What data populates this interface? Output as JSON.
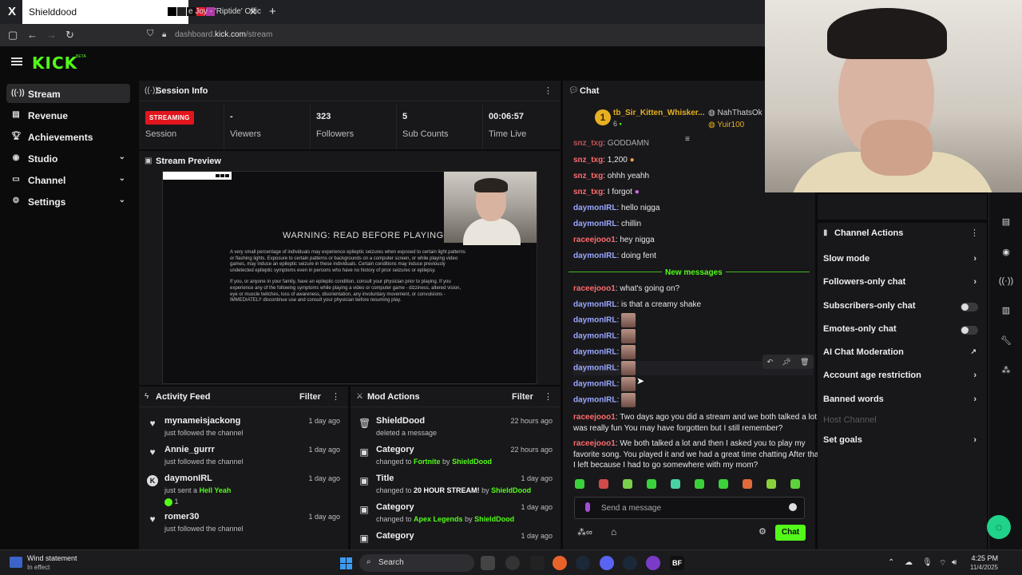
{
  "browser": {
    "active_tab_title": "Shielddood",
    "inactive_tab_title": "e Joy - 'Riptide' Offic",
    "url_prefix": "dashboard.",
    "url_host": "kick.com",
    "url_path": "/stream"
  },
  "header": {
    "logo_text": "KICK",
    "logo_badge": "BETA"
  },
  "sidebar": {
    "items": [
      {
        "label": "Stream",
        "icon": "stream-icon",
        "active": true
      },
      {
        "label": "Revenue",
        "icon": "revenue-icon"
      },
      {
        "label": "Achievements",
        "icon": "trophy-icon"
      },
      {
        "label": "Studio",
        "icon": "studio-icon",
        "expandable": true
      },
      {
        "label": "Channel",
        "icon": "channel-icon",
        "expandable": true
      },
      {
        "label": "Settings",
        "icon": "gear-icon",
        "expandable": true
      }
    ]
  },
  "session": {
    "title": "Session Info",
    "status_badge": "STREAMING",
    "session_label": "Session",
    "viewers_value": "-",
    "viewers_label": "Viewers",
    "followers_value": "323",
    "followers_label": "Followers",
    "subs_value": "5",
    "subs_label": "Sub Counts",
    "time_value": "00:06:57",
    "time_label": "Time Live"
  },
  "preview": {
    "title": "Stream Preview",
    "warning_title": "WARNING: READ BEFORE PLAYING",
    "warning_p1": "A very small percentage of individuals may experience epileptic seizures when exposed to certain light patterns or flashing lights. Exposure to certain patterns or backgrounds on a computer screen, or while playing video games, may induce an epileptic seizure in these individuals. Certain conditions may induce previously undetected epileptic symptoms even in persons who have no history of prior seizures or epilepsy.",
    "warning_p2": "If you, or anyone in your family, have an epileptic condition, consult your physician prior to playing. If you experience any of the following symptoms while playing a video or computer game - dizziness, altered vision, eye or muscle twitches, loss of awareness, disorientation, any involuntary movement, or convulsions - IMMEDIATELY discontinue use and consult your physician before resuming play."
  },
  "activity": {
    "title": "Activity Feed",
    "filter_label": "Filter",
    "rows": [
      {
        "name": "mynameisjackong",
        "sub": "just followed the channel",
        "highlight": "",
        "time": "1 day ago",
        "icon": "heart-icon"
      },
      {
        "name": "Annie_gurrr",
        "sub": "just followed the channel",
        "highlight": "",
        "time": "1 day ago",
        "icon": "heart-icon"
      },
      {
        "name": "daymonIRL",
        "sub": "just sent a ",
        "highlight": "Hell Yeah",
        "time": "1 day ago",
        "icon": "kick-icon",
        "extra": "1"
      },
      {
        "name": "romer30",
        "sub": "just followed the channel",
        "highlight": "",
        "time": "1 day ago",
        "icon": "heart-icon"
      }
    ]
  },
  "mod": {
    "title": "Mod Actions",
    "filter_label": "Filter",
    "rows": [
      {
        "name": "ShieldDood",
        "sub": "deleted a message",
        "time": "22 hours ago",
        "icon": "trash-icon"
      },
      {
        "name": "Category",
        "sub_pre": "changed to ",
        "sub_val": "Fortnite",
        "sub_by": " by ",
        "sub_user": "ShieldDood",
        "time": "22 hours ago",
        "icon": "category-icon"
      },
      {
        "name": "Title",
        "sub_pre": "changed to ",
        "sub_val": "20 HOUR STREAM!",
        "sub_by": " by ",
        "sub_user": "ShieldDood",
        "time": "1 day ago",
        "icon": "title-icon"
      },
      {
        "name": "Category",
        "sub_pre": "changed to ",
        "sub_val": "Apex Legends",
        "sub_by": " by ",
        "sub_user": "ShieldDood",
        "time": "1 day ago",
        "icon": "category-icon"
      },
      {
        "name": "Category",
        "sub_pre": "",
        "sub_val": "",
        "sub_by": "",
        "sub_user": "",
        "time": "1 day ago",
        "icon": "category-icon"
      }
    ]
  },
  "chat": {
    "title": "Chat",
    "top_gifter_rank": "1",
    "top_gifter_name": "tb_Sir_Kitten_Whisker...",
    "top_gifter_count": "6",
    "other_gifter_1": "NahThatsOk",
    "other_gifter_2": "Yuir100",
    "new_messages_label": "New messages",
    "input_placeholder": "Send a message",
    "send_label": "Chat",
    "messages": [
      {
        "user": "snz_txg",
        "color": "red",
        "text": "GODDAMN"
      },
      {
        "user": "snz_txg",
        "color": "red",
        "text": "1,200"
      },
      {
        "user": "snz_txg",
        "color": "red",
        "text": "ohhh yeahh"
      },
      {
        "user": "snz_txg",
        "color": "red",
        "text": "I forgot"
      },
      {
        "user": "daymonIRL",
        "color": "blue",
        "text": "hello nigga"
      },
      {
        "user": "daymonIRL",
        "color": "blue",
        "text": "chillin"
      },
      {
        "user": "raceejooo1",
        "color": "red",
        "text": "hey nigga"
      },
      {
        "user": "daymonIRL",
        "color": "blue",
        "text": "doing fent"
      },
      {
        "user": "raceejooo1",
        "color": "red",
        "text": "what's going on?"
      },
      {
        "user": "daymonIRL",
        "color": "blue",
        "text": "is that a creamy shake"
      },
      {
        "user": "daymonIRL",
        "color": "blue",
        "text": ""
      },
      {
        "user": "daymonIRL",
        "color": "blue",
        "text": ""
      },
      {
        "user": "daymonIRL",
        "color": "blue",
        "text": ""
      },
      {
        "user": "daymonIRL",
        "color": "blue",
        "text": ""
      },
      {
        "user": "daymonIRL",
        "color": "blue",
        "text": ""
      },
      {
        "user": "daymonIRL",
        "color": "blue",
        "text": ""
      },
      {
        "user": "raceejooo1",
        "color": "red",
        "text": "Two days ago you did a stream and we both talked a lot it",
        "text2": "was really fun You may have forgotten but I still remember?"
      },
      {
        "user": "raceejooo1",
        "color": "red",
        "text": "We both talked a lot and then I asked you to play my",
        "text2": "favorite song. You played it and we had a great time chatting After that",
        "text3": "I left because I had to go somewhere with my mom?"
      }
    ]
  },
  "channel_actions": {
    "title": "Channel Actions",
    "items": [
      {
        "label": "Slow mode",
        "control": "chevron"
      },
      {
        "label": "Followers-only chat",
        "control": "chevron"
      },
      {
        "label": "Subscribers-only chat",
        "control": "toggle"
      },
      {
        "label": "Emotes-only chat",
        "control": "toggle"
      },
      {
        "label": "AI Chat Moderation",
        "control": "link"
      },
      {
        "label": "Account age restriction",
        "control": "chevron"
      },
      {
        "label": "Banned words",
        "control": "chevron"
      },
      {
        "label": "Host Channel",
        "control": "none",
        "disabled": true
      },
      {
        "label": "Set goals",
        "control": "chevron"
      }
    ]
  },
  "taskbar": {
    "weather_title": "Wind statement",
    "weather_sub": "In effect",
    "search_label": "Search",
    "time": "4:25 PM",
    "date": "11/4/2025"
  },
  "colors": {
    "accent": "#53fc18",
    "live": "#e1161c",
    "panel": "#18181b",
    "bg": "#0b0b0c"
  }
}
